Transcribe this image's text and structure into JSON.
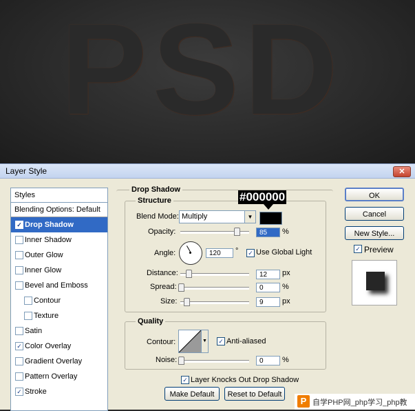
{
  "canvas": {
    "artwork_text": "PSD"
  },
  "dialog": {
    "title": "Layer Style",
    "close_glyph": "✕",
    "styles_header": "Styles",
    "blending_options": "Blending Options: Default",
    "style_items": [
      {
        "label": "Drop Shadow",
        "checked": true,
        "selected": true
      },
      {
        "label": "Inner Shadow",
        "checked": false
      },
      {
        "label": "Outer Glow",
        "checked": false
      },
      {
        "label": "Inner Glow",
        "checked": false
      },
      {
        "label": "Bevel and Emboss",
        "checked": false
      },
      {
        "label": "Contour",
        "checked": false,
        "indent": true
      },
      {
        "label": "Texture",
        "checked": false,
        "indent": true
      },
      {
        "label": "Satin",
        "checked": false
      },
      {
        "label": "Color Overlay",
        "checked": true
      },
      {
        "label": "Gradient Overlay",
        "checked": false
      },
      {
        "label": "Pattern Overlay",
        "checked": false
      },
      {
        "label": "Stroke",
        "checked": true
      }
    ],
    "section_title": "Drop Shadow",
    "structure": {
      "label": "Structure",
      "blend_mode_label": "Blend Mode:",
      "blend_mode_value": "Multiply",
      "opacity_label": "Opacity:",
      "opacity_value": "85",
      "opacity_unit": "%",
      "angle_label": "Angle:",
      "angle_value": "120",
      "angle_unit": "°",
      "use_global_light": "Use Global Light",
      "distance_label": "Distance:",
      "distance_value": "12",
      "distance_unit": "px",
      "spread_label": "Spread:",
      "spread_value": "0",
      "spread_unit": "%",
      "size_label": "Size:",
      "size_value": "9",
      "size_unit": "px"
    },
    "quality": {
      "label": "Quality",
      "contour_label": "Contour:",
      "anti_aliased": "Anti-aliased",
      "noise_label": "Noise:",
      "noise_value": "0",
      "noise_unit": "%"
    },
    "layer_knocks_out": "Layer Knocks Out Drop Shadow",
    "make_default": "Make Default",
    "reset_to_default": "Reset to Default",
    "ok": "OK",
    "cancel": "Cancel",
    "new_style": "New Style...",
    "preview": "Preview",
    "color_tooltip": "#000000",
    "shadow_color": "#000000"
  },
  "watermark": {
    "logo": "P",
    "text": "自学PHP网_php学习_php教"
  }
}
